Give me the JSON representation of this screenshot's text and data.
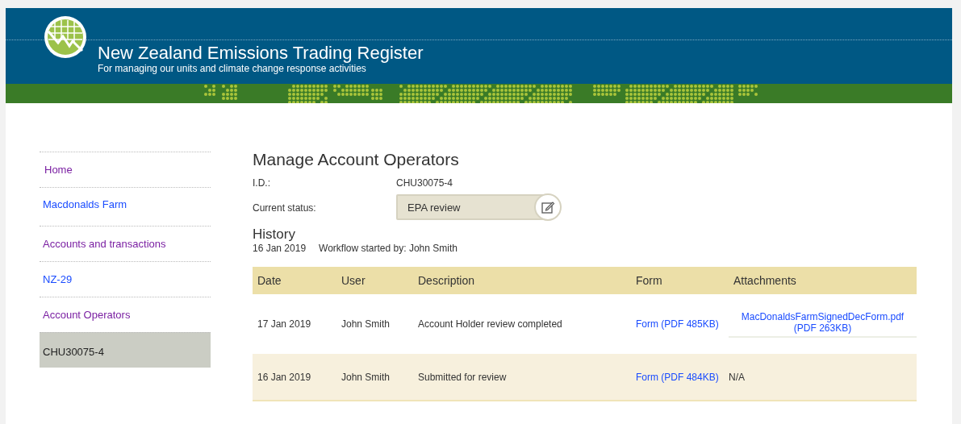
{
  "header": {
    "title": "New Zealand Emissions Trading Register",
    "subtitle": "For managing our units and climate change response activities"
  },
  "sidebar": {
    "items": [
      {
        "label": "Home",
        "visited": true,
        "selected": false
      },
      {
        "label": "Macdonalds Farm",
        "visited": false,
        "selected": false
      },
      {
        "label": "Accounts and transactions",
        "visited": true,
        "selected": false
      },
      {
        "label": "NZ-29",
        "visited": false,
        "selected": false
      },
      {
        "label": "Account Operators",
        "visited": true,
        "selected": false
      },
      {
        "label": "CHU30075-4",
        "visited": false,
        "selected": true
      }
    ]
  },
  "main": {
    "title": "Manage Account Operators",
    "fields": [
      {
        "label": "I.D.:",
        "value": "CHU30075-4",
        "kind": "text"
      },
      {
        "label": "Current status:",
        "value": "EPA review",
        "kind": "status"
      }
    ],
    "history": {
      "title": "History",
      "date": "16 Jan 2019",
      "note": "Workflow started by: John Smith"
    },
    "table": {
      "columns": [
        "Date",
        "User",
        "Description",
        "Form",
        "Attachments"
      ],
      "rows": [
        {
          "date": "17 Jan 2019",
          "user": "John Smith",
          "description": "Account Holder review completed",
          "form": "Form (PDF 485KB)",
          "attachment": {
            "kind": "link",
            "text": "MacDonaldsFarmSignedDecForm.pdf",
            "size": "(PDF 263KB)"
          }
        },
        {
          "date": "16 Jan 2019",
          "user": "John Smith",
          "description": "Submitted for review",
          "form": "Form (PDF 484KB)",
          "attachment": {
            "kind": "text",
            "text": "N/A"
          }
        }
      ]
    }
  }
}
